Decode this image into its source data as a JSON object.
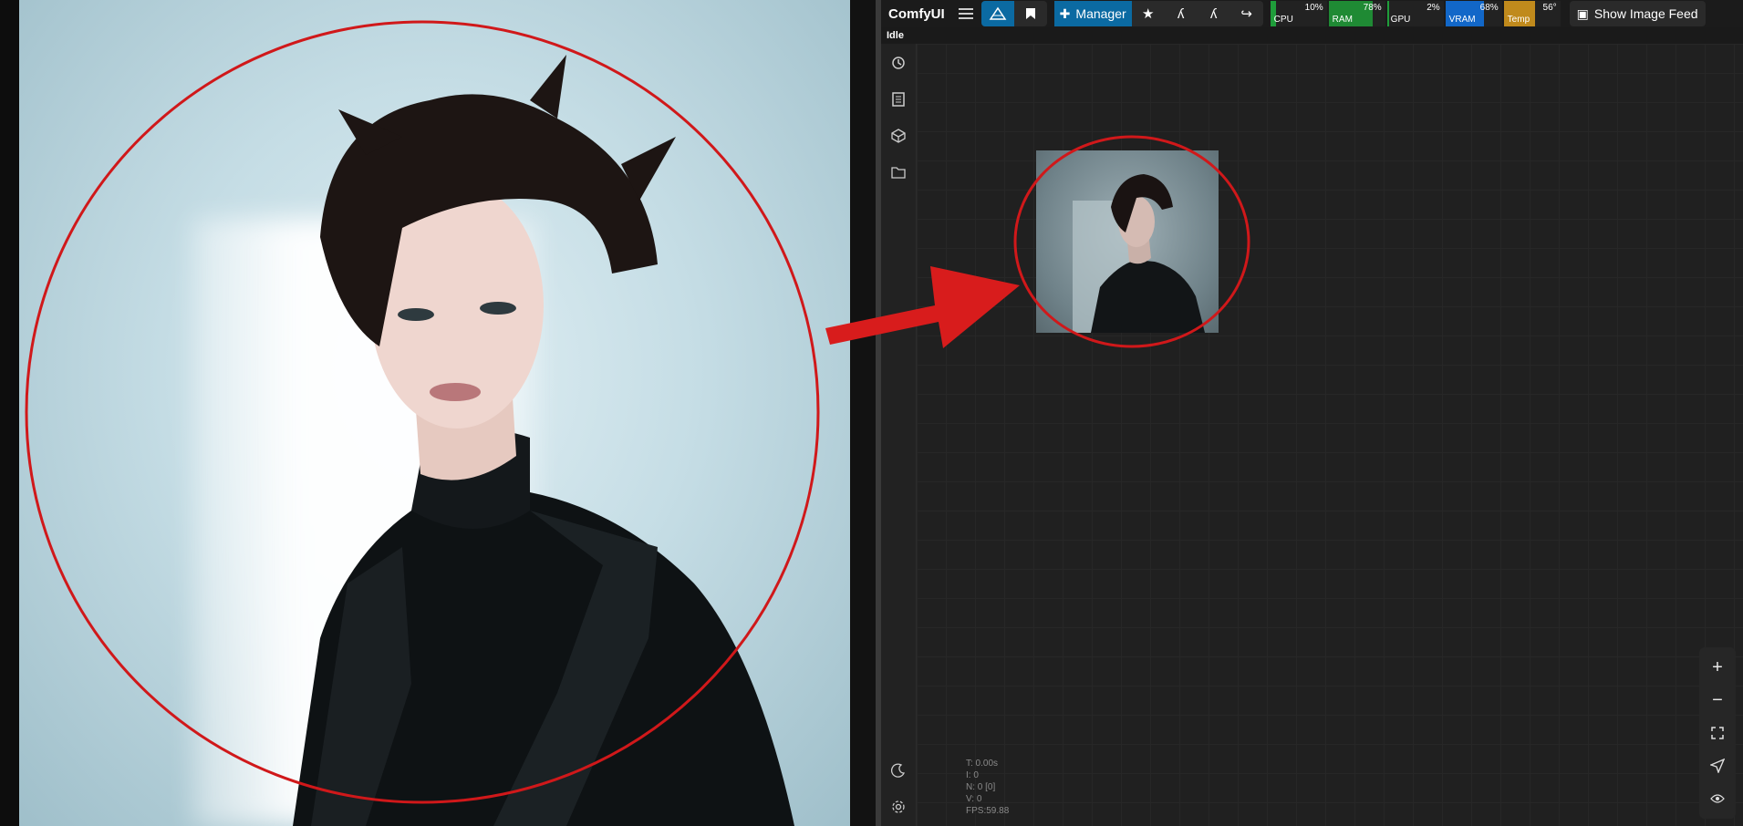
{
  "app": {
    "brand": "ComfyUI",
    "status": "Idle"
  },
  "toolbar": {
    "manager_label": "Manager",
    "show_feed_label": "Show Image Feed"
  },
  "meters": [
    {
      "label": "CPU",
      "value": "10%",
      "color": "#1f9d3a",
      "fraction": 0.1
    },
    {
      "label": "RAM",
      "value": "78%",
      "color": "#1f8a34",
      "fraction": 0.78
    },
    {
      "label": "GPU",
      "value": "2%",
      "color": "#1f9d3a",
      "fraction": 0.02
    },
    {
      "label": "VRAM",
      "value": "68%",
      "color": "#1267c8",
      "fraction": 0.68
    },
    {
      "label": "Temp",
      "value": "56°",
      "color": "#c08a1c",
      "fraction": 0.56
    }
  ],
  "stats": {
    "t": "T: 0.00s",
    "i": "I: 0",
    "n": "N: 0 [0]",
    "v": "V: 0",
    "fps": "FPS:59.88"
  },
  "colors": {
    "annotation": "#d0181a",
    "accent": "#0b6aa2"
  },
  "icons": {
    "sidebar": [
      "history-icon",
      "queue-icon",
      "model-library-icon",
      "workflows-icon",
      "theme-toggle-icon",
      "settings-icon"
    ],
    "zoom": [
      "zoom-in-icon",
      "zoom-out-icon",
      "fit-view-icon",
      "select-mode-icon",
      "toggle-visibility-icon"
    ]
  }
}
